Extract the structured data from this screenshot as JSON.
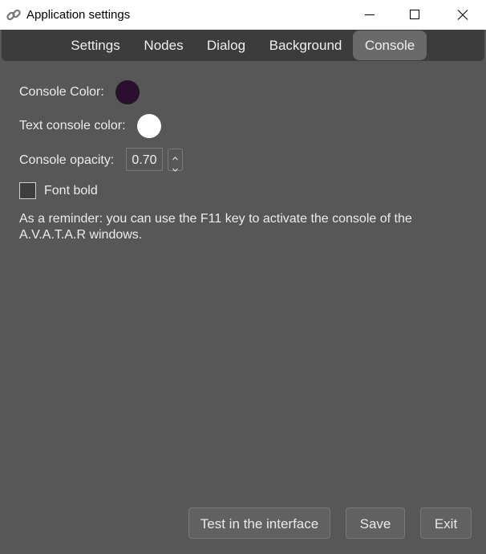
{
  "window": {
    "title": "Application settings",
    "icon": "chain-link-icon",
    "controls": [
      "minimize-icon",
      "maximize-icon",
      "close-icon"
    ]
  },
  "tabs": [
    {
      "label": "Settings",
      "active": false
    },
    {
      "label": "Nodes",
      "active": false
    },
    {
      "label": "Dialog",
      "active": false
    },
    {
      "label": "Background",
      "active": false
    },
    {
      "label": "Console",
      "active": true
    }
  ],
  "console": {
    "color_label": "Console Color:",
    "color_value": "#2a0f2e",
    "text_color_label": "Text console color:",
    "text_color_value": "#ffffff",
    "opacity_label": "Console opacity:",
    "opacity_value": "0.70",
    "font_bold_label": "Font bold",
    "font_bold_checked": false,
    "reminder": "As a reminder: you can use the F11 key to activate the console of the A.V.A.T.A.R windows."
  },
  "footer": {
    "test_label": "Test in the interface",
    "save_label": "Save",
    "exit_label": "Exit"
  },
  "colors": {
    "background": "#575757",
    "tab_bar": "#3c3c3c",
    "active_tab": "#6a6a6a",
    "titlebar": "#ffffff"
  }
}
